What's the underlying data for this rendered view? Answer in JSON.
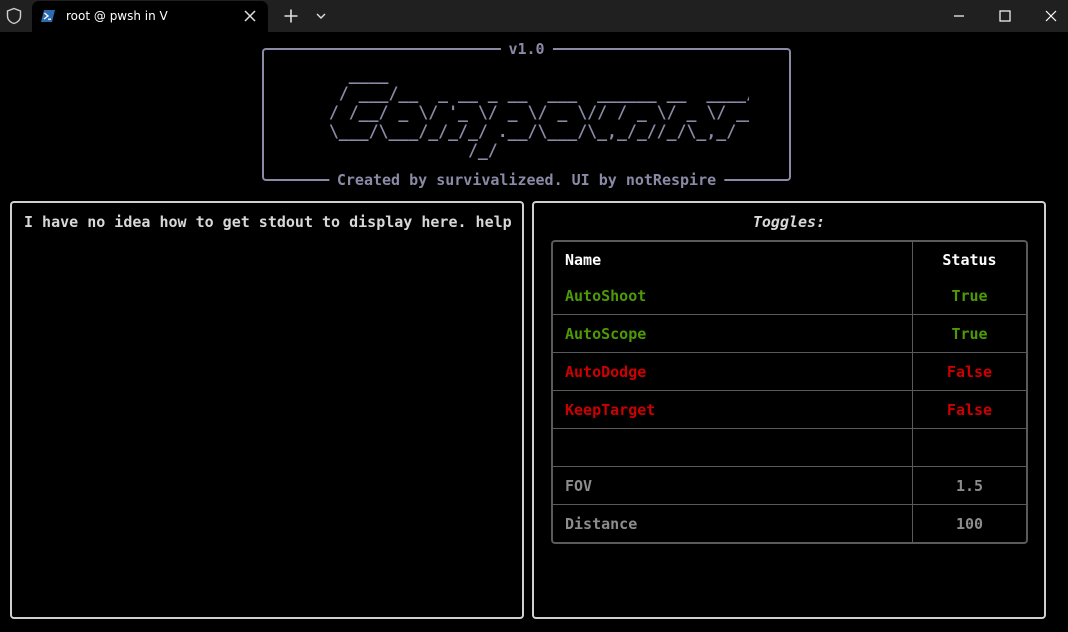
{
  "window": {
    "tab_title": "root @ pwsh in V"
  },
  "icons": {
    "shield": "shield-icon",
    "powershell": "powershell-icon",
    "close": "close-icon",
    "plus": "plus-icon",
    "chevron": "chevron-down-icon",
    "minimize": "minimize-icon",
    "maximize": "maximize-icon"
  },
  "banner": {
    "version": "v1.0",
    "credit": "Created by survivalizeed. UI by notRespire",
    "ascii_art": "    ____                                                __   __\n   / ___/__  _ __ _ __  ___  ______ __  ____/ /__| | / /\n  / /__/ _ \\/ '_ \\/ _ \\/ _ \\// / _ \\/ _ \\/ __/ |/ /\n  \\___/\\___/_/_/_/ .__/\\___/\\_,_/_//_/\\_,_/    |___/\n                /_/"
  },
  "output": {
    "text": "I have no idea how to get stdout to display here. help"
  },
  "toggles": {
    "title": "Toggles:",
    "headers": {
      "name": "Name",
      "status": "Status"
    },
    "rows": [
      {
        "name": "AutoShoot",
        "status": "True",
        "kind": "true"
      },
      {
        "name": "AutoScope",
        "status": "True",
        "kind": "true"
      },
      {
        "name": "AutoDodge",
        "status": "False",
        "kind": "false"
      },
      {
        "name": "KeepTarget",
        "status": "False",
        "kind": "false"
      },
      {
        "name": "",
        "status": "",
        "kind": "info"
      },
      {
        "name": "FOV",
        "status": "1.5",
        "kind": "info"
      },
      {
        "name": "Distance",
        "status": "100",
        "kind": "info"
      }
    ]
  },
  "colors": {
    "true": "#4e9a06",
    "false": "#cc0000",
    "info": "#8c8c8c",
    "banner": "#8a8aa6",
    "border": "#d0d0d0"
  }
}
